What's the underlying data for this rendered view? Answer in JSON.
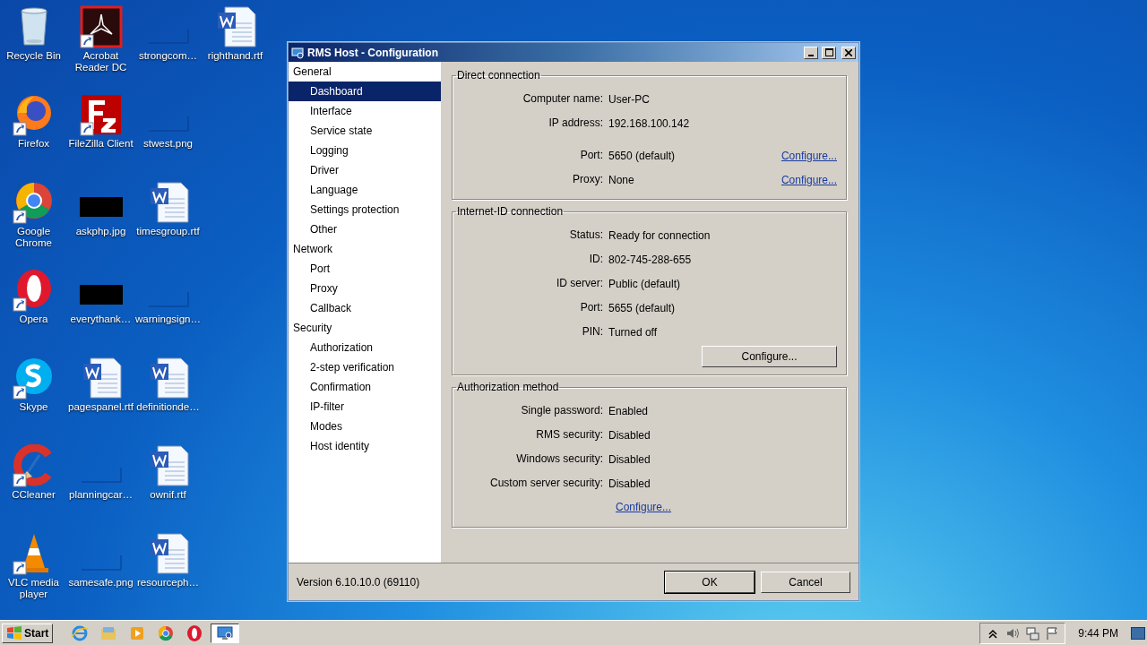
{
  "desktop": {
    "icons": [
      {
        "label": "Recycle Bin",
        "kind": "recycle-bin",
        "shortcut": false
      },
      {
        "label": "Firefox",
        "kind": "firefox",
        "shortcut": true
      },
      {
        "label": "Google Chrome",
        "kind": "chrome",
        "shortcut": true
      },
      {
        "label": "Opera",
        "kind": "opera",
        "shortcut": true
      },
      {
        "label": "Skype",
        "kind": "skype",
        "shortcut": true
      },
      {
        "label": "CCleaner",
        "kind": "ccleaner",
        "shortcut": true
      },
      {
        "label": "VLC media player",
        "kind": "vlc",
        "shortcut": true
      },
      {
        "label": "Acrobat Reader DC",
        "kind": "acrobat",
        "shortcut": true
      },
      {
        "label": "FileZilla Client",
        "kind": "filezilla",
        "shortcut": true
      },
      {
        "label": "askphp.jpg",
        "kind": "dark-image",
        "shortcut": false
      },
      {
        "label": "everythank…",
        "kind": "dark-image",
        "shortcut": false
      },
      {
        "label": "pagespanel.rtf",
        "kind": "document",
        "shortcut": false
      },
      {
        "label": "planningcar…",
        "kind": "blank-image",
        "shortcut": false
      },
      {
        "label": "samesafe.png",
        "kind": "blank-image",
        "shortcut": false
      },
      {
        "label": "strongcom…",
        "kind": "blank-image",
        "shortcut": false
      },
      {
        "label": "stwest.png",
        "kind": "blank-image",
        "shortcut": false
      },
      {
        "label": "timesgroup.rtf",
        "kind": "document",
        "shortcut": false
      },
      {
        "label": "warningsign…",
        "kind": "blank-image",
        "shortcut": false
      },
      {
        "label": "definitionde…",
        "kind": "document",
        "shortcut": false
      },
      {
        "label": "ownif.rtf",
        "kind": "document",
        "shortcut": false
      },
      {
        "label": "resourceph…",
        "kind": "document",
        "shortcut": false
      },
      {
        "label": "righthand.rtf",
        "kind": "document",
        "shortcut": false
      }
    ]
  },
  "window": {
    "title": "RMS Host - Configuration"
  },
  "sidebar": {
    "sections": [
      {
        "label": "General",
        "selected": false,
        "children": [
          {
            "label": "Dashboard",
            "selected": true
          },
          {
            "label": "Interface",
            "selected": false
          },
          {
            "label": "Service state",
            "selected": false
          },
          {
            "label": "Logging",
            "selected": false
          },
          {
            "label": "Driver",
            "selected": false
          },
          {
            "label": "Language",
            "selected": false
          },
          {
            "label": "Settings protection",
            "selected": false
          },
          {
            "label": "Other",
            "selected": false
          }
        ]
      },
      {
        "label": "Network",
        "selected": false,
        "children": [
          {
            "label": "Port",
            "selected": false
          },
          {
            "label": "Proxy",
            "selected": false
          },
          {
            "label": "Callback",
            "selected": false
          }
        ]
      },
      {
        "label": "Security",
        "selected": false,
        "children": [
          {
            "label": "Authorization",
            "selected": false
          },
          {
            "label": "2-step verification",
            "selected": false
          },
          {
            "label": "Confirmation",
            "selected": false
          },
          {
            "label": "IP-filter",
            "selected": false
          },
          {
            "label": "Modes",
            "selected": false
          },
          {
            "label": "Host identity",
            "selected": false
          }
        ]
      }
    ]
  },
  "groups": [
    {
      "title": "Direct connection",
      "rows": [
        {
          "label": "Computer name:",
          "value": "User-PC"
        },
        {
          "label": "IP address:",
          "value": "192.168.100.142"
        },
        {
          "label": "Port:",
          "value": "5650 (default)",
          "link": "Configure..."
        },
        {
          "label": "Proxy:",
          "value": "None",
          "link": "Configure..."
        }
      ]
    },
    {
      "title": "Internet-ID connection",
      "rows": [
        {
          "label": "Status:",
          "value": "Ready for connection"
        },
        {
          "label": "ID:",
          "value": "802-745-288-655"
        },
        {
          "label": "ID server:",
          "value": "Public (default)"
        },
        {
          "label": "Port:",
          "value": "5655 (default)"
        },
        {
          "label": "PIN:",
          "value": "Turned off"
        }
      ],
      "button": "Configure..."
    },
    {
      "title": "Authorization method",
      "rows": [
        {
          "label": "Single password:",
          "value": "Enabled"
        },
        {
          "label": "RMS security:",
          "value": "Disabled"
        },
        {
          "label": "Windows security:",
          "value": "Disabled"
        },
        {
          "label": "Custom server security:",
          "value": "Disabled"
        }
      ],
      "link": "Configure..."
    }
  ],
  "footer": {
    "version": "Version 6.10.10.0 (69110)",
    "buttons": [
      {
        "label": "OK",
        "default": true
      },
      {
        "label": "Cancel",
        "default": false
      }
    ]
  },
  "taskbar": {
    "start": "Start",
    "apps": [
      {
        "kind": "ie",
        "active": false
      },
      {
        "kind": "explorer",
        "active": false
      },
      {
        "kind": "media",
        "active": false
      },
      {
        "kind": "chrome",
        "active": false
      },
      {
        "kind": "opera",
        "active": false
      },
      {
        "kind": "rms",
        "active": true
      }
    ],
    "clock": "9:44 PM"
  }
}
